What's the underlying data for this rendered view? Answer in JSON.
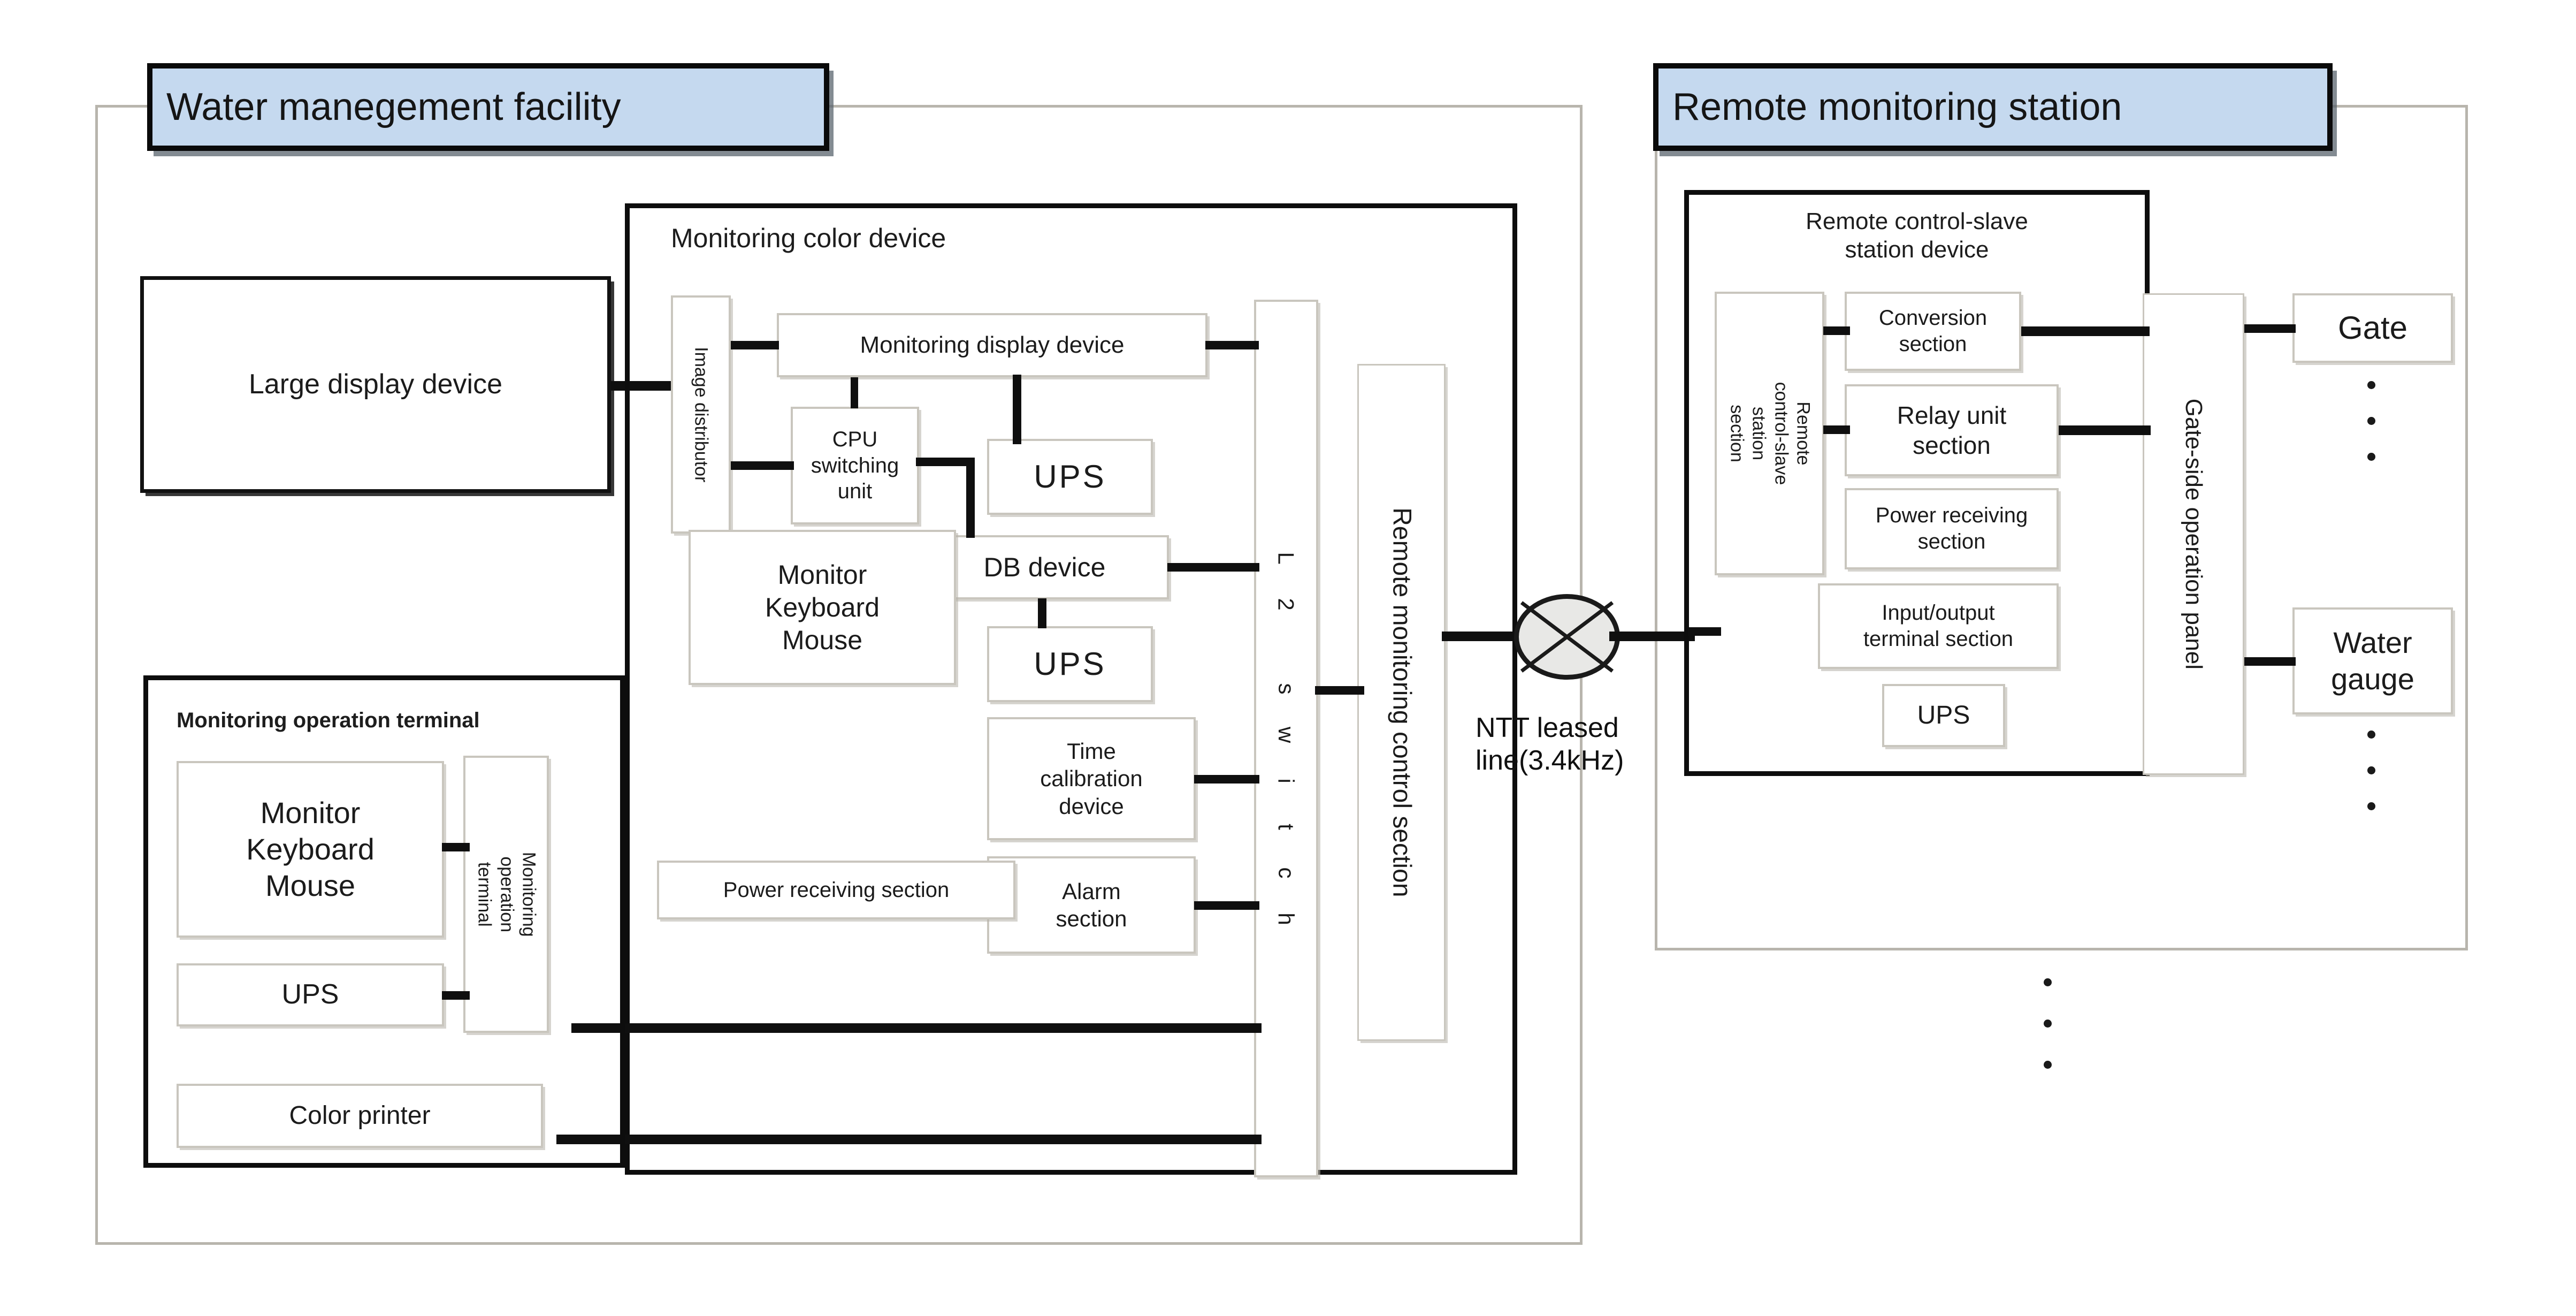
{
  "diagram": {
    "left_station": {
      "title": "Water manegement facility",
      "large_display": "Large display device",
      "monitoring_color_device": {
        "caption": "Monitoring color device",
        "image_distributor": "Image distributor",
        "monitoring_display_device": "Monitoring display device",
        "cpu_switching_unit": "CPU\nswitching\nunit",
        "ups_top": "UPS",
        "monitor_keyboard_mouse": "Monitor\nKeyboard\nMouse",
        "db_device": "DB device",
        "ups_mid": "UPS",
        "time_calibration_device": "Time\ncalibration\ndevice",
        "alarm_section": "Alarm\nsection",
        "power_receiving_section": "Power receiving  section",
        "l2_switch_letters": [
          "L",
          "2",
          "",
          "s",
          "w",
          "i",
          "t",
          "c",
          "h"
        ],
        "l2_switch_label": "L2 switch"
      },
      "remote_monitoring_control_section": "Remote monitoring control section",
      "monitoring_operation_terminal_group": {
        "caption": "Monitoring operation terminal",
        "monitor_keyboard_mouse": "Monitor\nKeyboard\nMouse",
        "ups": "UPS",
        "color_printer": "Color printer",
        "terminal_vertical": "Monitoring operation\nterminal"
      }
    },
    "link": {
      "label_line1": "NTT leased",
      "label_line2": "line(3.4kHz)",
      "node": "crossed-circle-node"
    },
    "right_station": {
      "title": "Remote monitoring station",
      "remote_control_slave_station_device": {
        "caption": "Remote control-slave\nstation device",
        "remote_control_slave_station_section": "Remote control-slave\nstation section",
        "conversion_section": "Conversion\nsection",
        "relay_unit_section": "Relay unit\nsection",
        "power_receiving_section": "Power receiving\nsection",
        "input_output_terminal_section": "Input/output\nterminal section",
        "ups": "UPS"
      },
      "gate_side_operation_panel": "Gate-side operation panel",
      "gate": "Gate",
      "water_gauge": "Water\ngauge"
    },
    "colors": {
      "plaque_fill": "#c5d9ef",
      "plaque_border": "#0a0a0a",
      "box_border": "#c9c6be",
      "connector": "#0f0f0f",
      "outer_frame": "#b8b5ad"
    }
  }
}
